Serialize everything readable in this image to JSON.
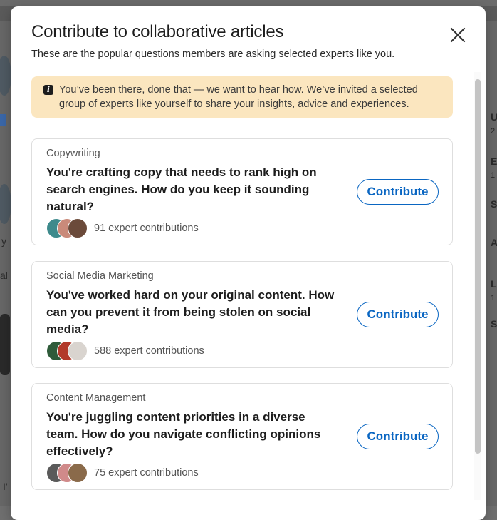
{
  "modal": {
    "title": "Contribute to collaborative articles",
    "subtitle": "These are the popular questions members are asking selected experts like you.",
    "close_icon": "close-icon"
  },
  "notice": {
    "icon": "info-icon",
    "icon_glyph": "i",
    "text": "You’ve been there, done that — we want to hear how. We’ve invited a selected group of experts like yourself to share your insights, advice and experiences."
  },
  "cards": [
    {
      "category": "Copywriting",
      "question": "You're crafting copy that needs to rank high on search engines. How do you keep it sounding natural?",
      "button_label": "Contribute",
      "contributions": "91 expert contributions",
      "avatar_colors": [
        "#3e8a8c",
        "#c98a7a",
        "#6b4a3a"
      ]
    },
    {
      "category": "Social Media Marketing",
      "question": "You've worked hard on your original content. How can you prevent it from being stolen on social media?",
      "button_label": "Contribute",
      "contributions": "588 expert contributions",
      "avatar_colors": [
        "#2f5b3a",
        "#b23a2a",
        "#d9d4cf"
      ]
    },
    {
      "category": "Content Management",
      "question": "You're juggling content priorities in a diverse team. How do you navigate conflicting opinions effectively?",
      "button_label": "Contribute",
      "contributions": "75 expert contributions",
      "avatar_colors": [
        "#5a5a5a",
        "#d08a8a",
        "#8a6a4a"
      ]
    }
  ],
  "background": {
    "fragments": [
      "U",
      "2",
      "E",
      "1",
      "S",
      "A",
      "L",
      "1",
      "S",
      "y",
      "al",
      "I'"
    ]
  }
}
